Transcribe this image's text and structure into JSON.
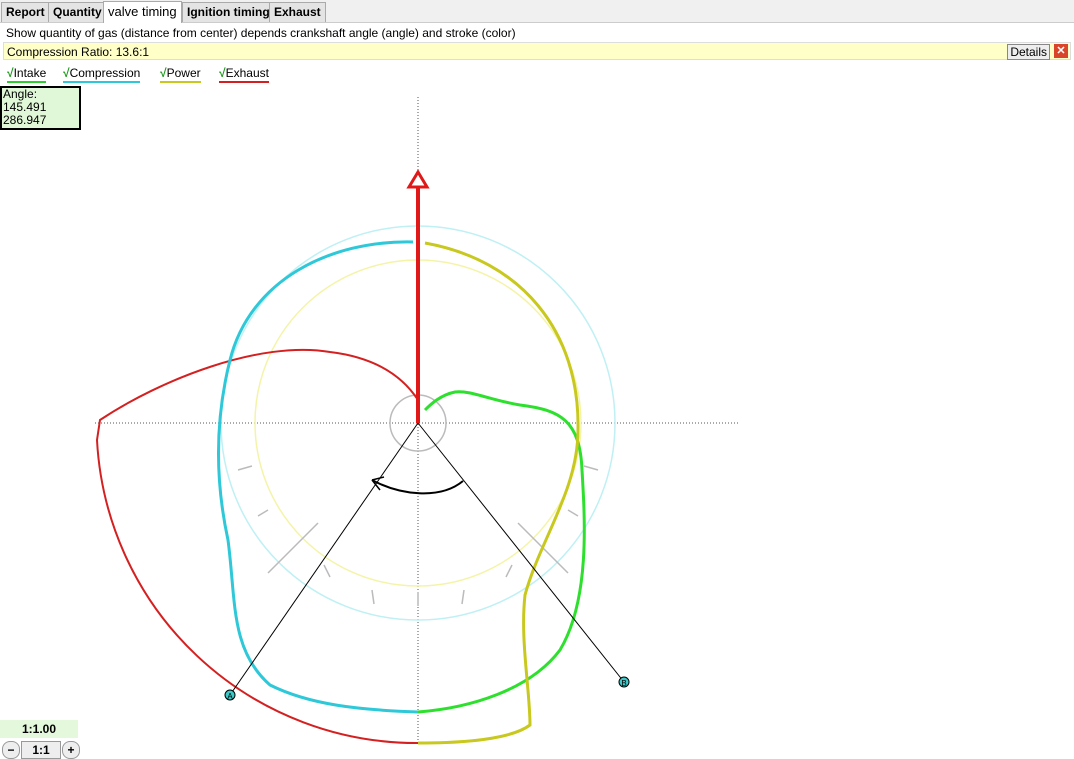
{
  "tabs": [
    "Report",
    "Quantity",
    "valve timing",
    "Ignition timing",
    "Exhaust"
  ],
  "description": "Show quantity of gas (distance from center) depends crankshaft angle (angle) and stroke (color)",
  "compression_ratio": "Compression Ratio: 13.6:1",
  "details_label": "Details",
  "close_label": "✕",
  "legend": [
    {
      "label": "Intake",
      "color": "#2ecc2e"
    },
    {
      "label": "Compression",
      "color": "#2ec8d8"
    },
    {
      "label": "Power",
      "color": "#c8c81e"
    },
    {
      "label": "Exhaust",
      "color": "#d42020"
    }
  ],
  "check": "√",
  "angle": {
    "label": "Angle:",
    "v1": "145.491",
    "v2": "286.947"
  },
  "markers": {
    "a": "A",
    "b": "B"
  },
  "zoom": {
    "level": "1:1.00",
    "minus": "−",
    "reset": "1:1",
    "plus": "+"
  }
}
